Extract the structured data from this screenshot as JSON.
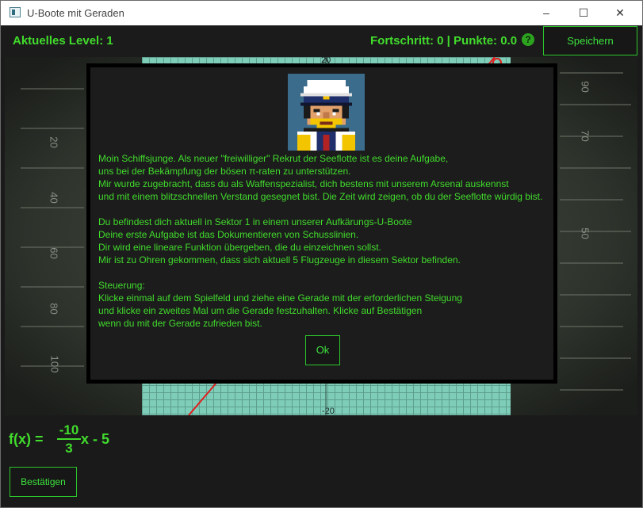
{
  "window": {
    "title": "U-Boote mit Geraden",
    "controls": {
      "minimize": "–",
      "maximize": "☐",
      "close": "✕"
    }
  },
  "topbar": {
    "level": "Aktuelles Level: 1",
    "progress": "Fortschritt: 0 | Punkte: 0.0",
    "help_icon": "question-mark-icon",
    "help_glyph": "?",
    "save_label": "Speichern"
  },
  "game": {
    "axis_label_top": "20",
    "axis_label_bottom": "-20",
    "periscope_scale_right": [
      "90",
      "70",
      "50"
    ],
    "periscope_scale_left": [
      "20",
      "40",
      "60",
      "80",
      "100"
    ],
    "colors": {
      "accent": "#41dc2c",
      "grid": "#7ecdb9",
      "line": "#e01c1c"
    }
  },
  "dialog": {
    "portrait": "captain-portrait",
    "lines": [
      "Moin Schiffsjunge. Als neuer \"freiwilliger\" Rekrut der Seeflotte ist es deine Aufgabe,",
      "uns bei der Bekämpfung der bösen π-raten zu unterstützen.",
      "Mir wurde zugebracht, dass du als Waffenspezialist, dich bestens mit unserem Arsenal auskennst",
      "und mit einem blitzschnellen Verstand gesegnet bist. Die Zeit wird zeigen, ob du der Seeflotte würdig bist.",
      "",
      "Du befindest dich aktuell in Sektor 1 in einem unserer Aufkärungs-U-Boote",
      "Deine erste Aufgabe ist das Dokumentieren von Schusslinien.",
      "Dir wird eine lineare Funktion übergeben, die du einzeichnen sollst.",
      "Mir ist zu Ohren gekommen, dass sich aktuell 5 Flugzeuge in diesem Sektor befinden.",
      "",
      "Steuerung:",
      "Klicke einmal auf dem Spielfeld und ziehe eine Gerade mit der erforderlichen Steigung",
      "und klicke ein zweites Mal um die Gerade festzuhalten. Klicke auf Bestätigen",
      "wenn du mit der Gerade zufrieden bist."
    ],
    "ok_label": "Ok"
  },
  "formula": {
    "prefix": "f(x) =",
    "numerator": "-10",
    "denominator": "3",
    "suffix": "x - 5"
  },
  "bottom": {
    "confirm_label": "Bestätigen"
  }
}
